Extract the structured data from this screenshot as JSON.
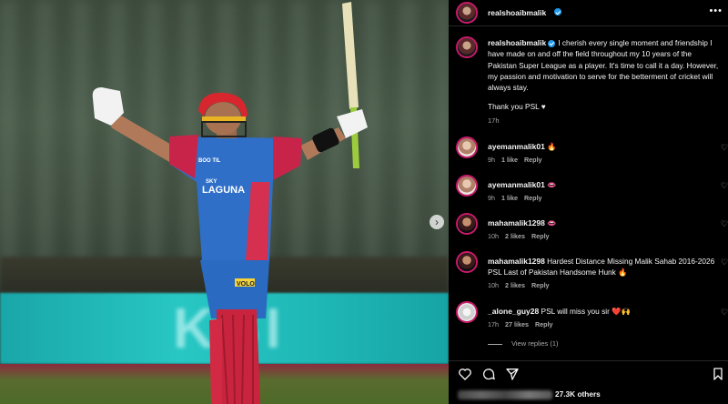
{
  "post": {
    "username": "realshoaibmalik",
    "caption": "I cherish every single moment and friendship I have made on and off the field throughout my 10 years of the Pakistan Super League as a player. It's time to call it a day. However, my passion and motivation to serve for the betterment of cricket will always stay.",
    "thanks": "Thank you PSL",
    "time": "17h",
    "likes": "27.3K others"
  },
  "photo": {
    "jersey_sponsor": "LAGUNA",
    "jersey_sponsor_small": "SKY",
    "belly_sponsor": "VOLO",
    "chest_sponsor": "BOO TIL",
    "banner_text": "KBI"
  },
  "comments": [
    {
      "username": "ayemanmalik01",
      "text": "🔥",
      "time": "9h",
      "likes": "1 like",
      "reply": "Reply"
    },
    {
      "username": "ayemanmalik01",
      "text": "👄",
      "time": "9h",
      "likes": "1 like",
      "reply": "Reply"
    },
    {
      "username": "mahamalik1298",
      "text": "👄",
      "time": "10h",
      "likes": "2 likes",
      "reply": "Reply"
    },
    {
      "username": "mahamalik1298",
      "text": "Hardest Distance Missing Malik Sahab 2016-2026 PSL Last of Pakistan Handsome Hunk 🔥",
      "time": "10h",
      "likes": "2 likes",
      "reply": "Reply"
    },
    {
      "username": "_alone_guy28",
      "text": "PSL will miss you sir ❤️🙌",
      "time": "17h",
      "likes": "27 likes",
      "reply": "Reply"
    }
  ],
  "view_replies": "View replies (1)",
  "icons": {
    "more": "more-options-icon",
    "like": "heart-icon",
    "comment": "comment-icon",
    "share": "share-icon",
    "save": "bookmark-icon",
    "next": "chevron-right-icon"
  },
  "colors": {
    "verified": "#1d9bf0",
    "story_ring": "#c91a6b",
    "background": "#000000"
  }
}
